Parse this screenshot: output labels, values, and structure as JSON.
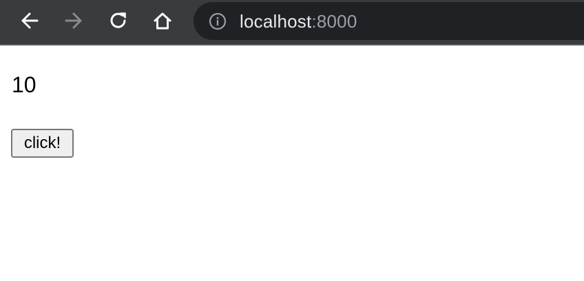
{
  "browser": {
    "url_host": "localhost",
    "url_port": ":8000",
    "icons": {
      "back": "arrow-left-icon",
      "forward": "arrow-right-icon",
      "reload": "reload-icon",
      "home": "home-icon",
      "info": "info-icon"
    },
    "colors": {
      "toolbar": "#3a3b3d",
      "omnibox": "#202124",
      "url_host": "#e8eaed",
      "url_port": "#9aa0a6",
      "icon_active": "#ffffff",
      "icon_disabled": "#8a8b8d"
    },
    "forward_enabled": false
  },
  "page": {
    "counter": "10",
    "button_label": "click!"
  }
}
